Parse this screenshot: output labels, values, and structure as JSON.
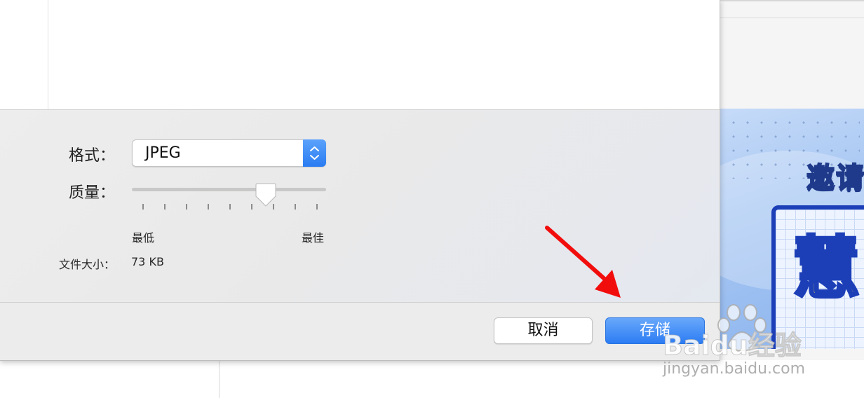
{
  "dialog": {
    "format_label": "格式：",
    "format_value": "JPEG",
    "quality_label": "质量：",
    "quality_level": 0.71,
    "quality_ticks": 9,
    "quality_min_label": "最低",
    "quality_max_label": "最佳",
    "filesize_label": "文件大小：",
    "filesize_value": "73 KB",
    "cancel_label": "取消",
    "save_label": "存储"
  },
  "background_document": {
    "title_partial": "邀请",
    "board_char_partial": "慧"
  },
  "watermark": {
    "brand": "Baidu经验",
    "url": "jingyan.baidu.com"
  },
  "colors": {
    "accent": "#2c7cf3",
    "annotation_arrow": "#f20d0d",
    "poster_border": "#1c3fb8",
    "poster_char": "#ffe23a"
  }
}
